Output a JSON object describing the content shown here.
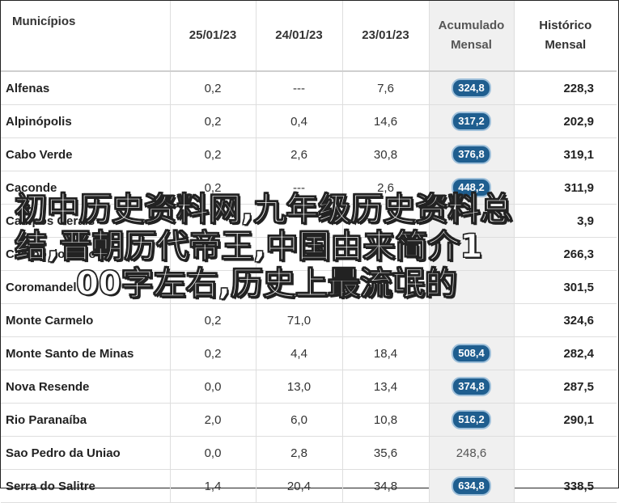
{
  "table": {
    "headers": {
      "municipio": "Municípios",
      "d1": "25/01/23",
      "d2": "24/01/23",
      "d3": "23/01/23",
      "acumulado_l1": "Acumulado",
      "acumulado_l2": "Mensal",
      "historico_l1": "Histórico",
      "historico_l2": "Mensal"
    },
    "rows": [
      {
        "name": "Alfenas",
        "d1": "0,2",
        "d2": "---",
        "d3": "7,6",
        "acum": "324,8",
        "badge": true,
        "hist": "228,3"
      },
      {
        "name": "Alpinópolis",
        "d1": "0,2",
        "d2": "0,4",
        "d3": "14,6",
        "acum": "317,2",
        "badge": true,
        "hist": "202,9"
      },
      {
        "name": "Cabo Verde",
        "d1": "0,2",
        "d2": "2,6",
        "d3": "30,8",
        "acum": "376,8",
        "badge": true,
        "hist": "319,1"
      },
      {
        "name": "Caconde",
        "d1": "0,2",
        "d2": "---",
        "d3": "2,6",
        "acum": "448,2",
        "badge": true,
        "hist": "311,9"
      },
      {
        "name": "Campos Gerais",
        "d1": "",
        "d2": "",
        "d3": "",
        "acum": "",
        "badge": true,
        "hist": "3,9"
      },
      {
        "name": "Campo do Meio",
        "d1": "",
        "d2": "",
        "d3": "",
        "acum": "",
        "badge": true,
        "hist": "266,3"
      },
      {
        "name": "Coromandel",
        "d1": "",
        "d2": "",
        "d3": "",
        "acum": "",
        "badge": true,
        "hist": "301,5"
      },
      {
        "name": "Monte Carmelo",
        "d1": "0,2",
        "d2": "71,0",
        "d3": "",
        "acum": "",
        "badge": true,
        "hist": "324,6"
      },
      {
        "name": "Monte Santo de Minas",
        "d1": "0,2",
        "d2": "4,4",
        "d3": "18,4",
        "acum": "508,4",
        "badge": true,
        "hist": "282,4"
      },
      {
        "name": "Nova Resende",
        "d1": "0,0",
        "d2": "13,0",
        "d3": "13,4",
        "acum": "374,8",
        "badge": true,
        "hist": "287,5"
      },
      {
        "name": "Rio Paranaíba",
        "d1": "2,0",
        "d2": "6,0",
        "d3": "10,8",
        "acum": "516,2",
        "badge": true,
        "hist": "290,1"
      },
      {
        "name": "Sao Pedro da Uniao",
        "d1": "0,0",
        "d2": "2,8",
        "d3": "35,6",
        "acum": "248,6",
        "badge": false,
        "hist": ""
      },
      {
        "name": "Serra do Salitre",
        "d1": "1,4",
        "d2": "20,4",
        "d3": "34,8",
        "acum": "634,8",
        "badge": true,
        "hist": "338,5"
      }
    ]
  },
  "overlay": {
    "line1": "初中历史资料网,九年级历史资料总",
    "line2": "结,晋朝历代帝王,中国由来简介1",
    "line3": "00字左右,历史上最流氓的"
  },
  "colors": {
    "badge_bg": "#1f5e8f",
    "badge_border": "#9fc0da",
    "acumulado_bg": "#f0f0f0"
  }
}
